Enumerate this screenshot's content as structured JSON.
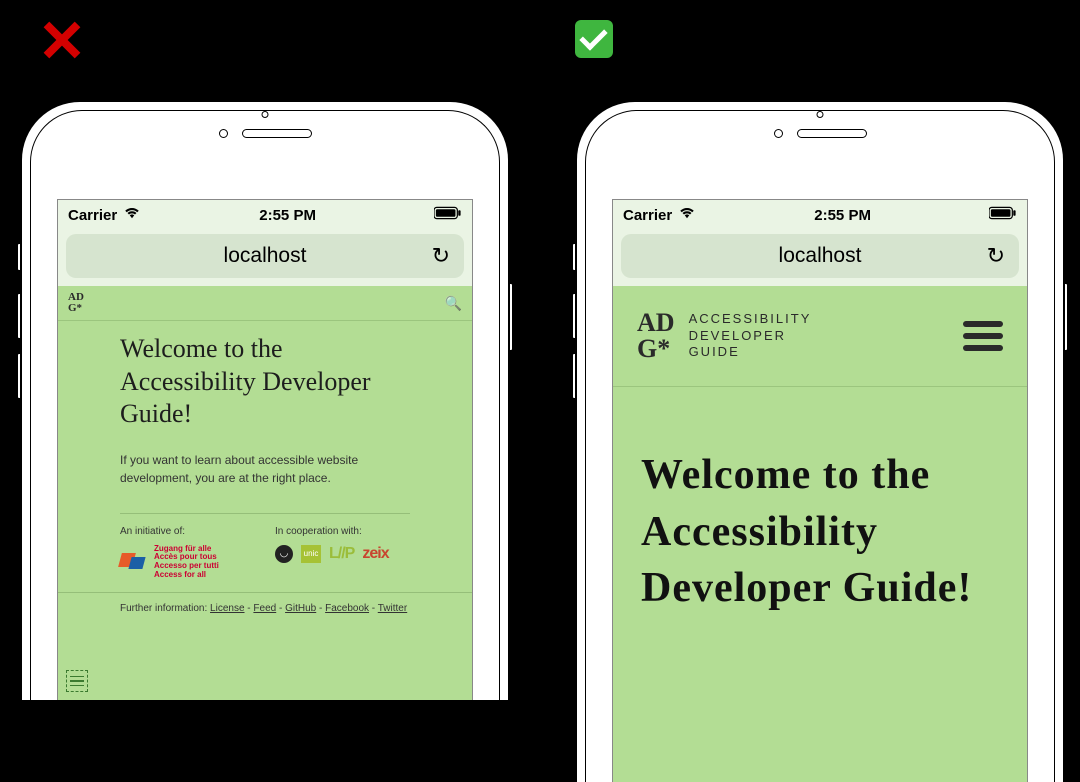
{
  "indicators": {
    "bad": "✕",
    "good": "✓"
  },
  "status": {
    "carrier": "Carrier",
    "time": "2:55 PM"
  },
  "browser": {
    "url": "localhost"
  },
  "bad": {
    "logo_line1": "AD",
    "logo_line2": "G*",
    "title": "Welcome to the Accessibility Developer Guide!",
    "paragraph": "If you want to learn about accessible website development, you are at the right place.",
    "initiative_label": "An initiative of:",
    "initiative_lines": {
      "l1": "Zugang für alle",
      "l2": "Accès pour tous",
      "l3": "Accesso per tutti",
      "l4": "Access for all"
    },
    "cooperation_label": "In cooperation with:",
    "coop": {
      "unic": "unic",
      "liip": "L//P",
      "zeix": "zeix"
    },
    "footer_prefix": "Further information:",
    "footer_links": {
      "license": "License",
      "feed": "Feed",
      "github": "GitHub",
      "facebook": "Facebook",
      "twitter": "Twitter"
    },
    "sep": " - "
  },
  "good": {
    "logo_line1": "AD",
    "logo_line2": "G*",
    "logo_text_l1": "ACCESSIBILITY",
    "logo_text_l2": "DEVELOPER",
    "logo_text_l3": "GUIDE",
    "title": "Welcome to the Accessibility Developer Guide!"
  }
}
